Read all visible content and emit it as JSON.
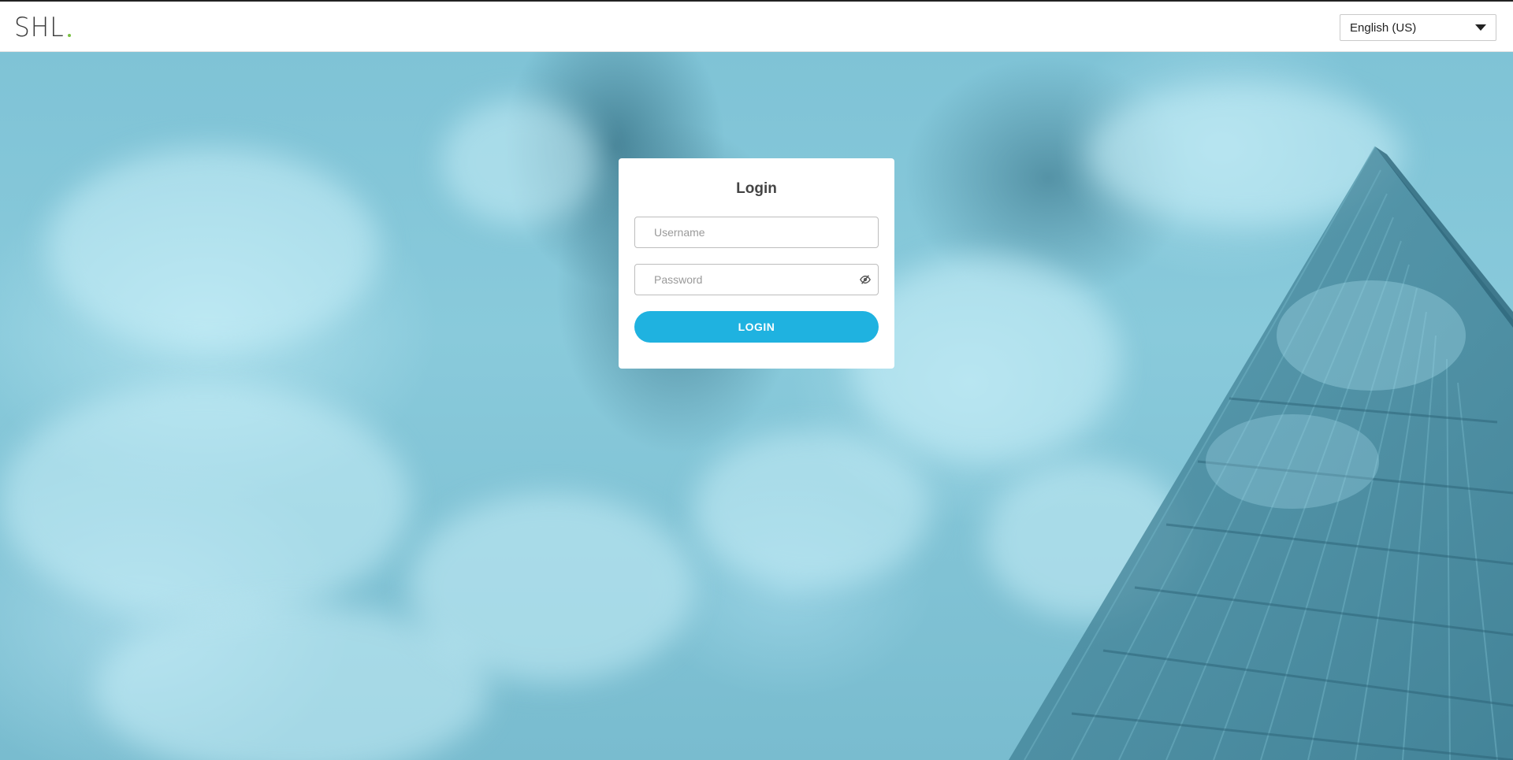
{
  "header": {
    "logo_text": "SHL",
    "logo_dot_color": "#7ac143",
    "language": {
      "selected": "English (US)",
      "icon": "chevron-down-icon"
    }
  },
  "login": {
    "title": "Login",
    "username_placeholder": "Username",
    "password_placeholder": "Password",
    "password_toggle_icon": "eye-slash-icon",
    "button_label": "LOGIN",
    "button_color": "#1fb2e0"
  }
}
